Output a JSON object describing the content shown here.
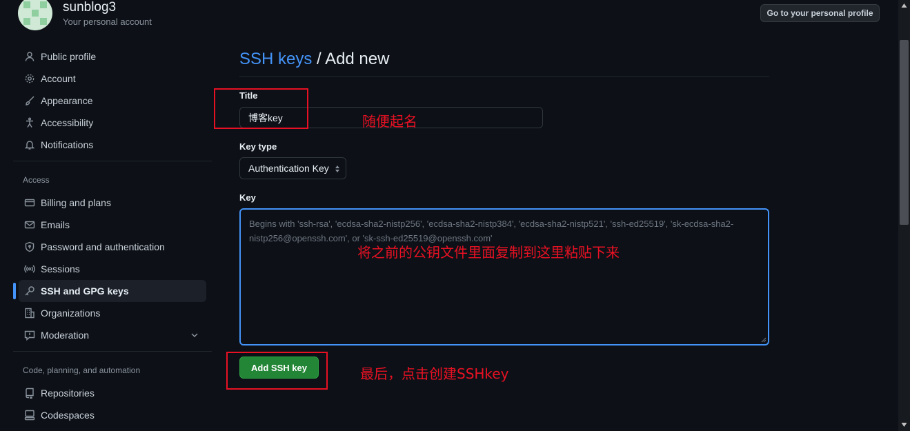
{
  "account": {
    "name": "sunblog3",
    "subtitle": "Your personal account",
    "profile_button": "Go to your personal profile"
  },
  "sidebar": {
    "items": [
      {
        "label": "Public profile",
        "icon": "person-icon"
      },
      {
        "label": "Account",
        "icon": "gear-icon"
      },
      {
        "label": "Appearance",
        "icon": "paintbrush-icon"
      },
      {
        "label": "Accessibility",
        "icon": "accessibility-icon"
      },
      {
        "label": "Notifications",
        "icon": "bell-icon"
      }
    ],
    "access_title": "Access",
    "access_items": [
      {
        "label": "Billing and plans",
        "icon": "credit-card-icon"
      },
      {
        "label": "Emails",
        "icon": "mail-icon"
      },
      {
        "label": "Password and authentication",
        "icon": "shield-lock-icon"
      },
      {
        "label": "Sessions",
        "icon": "broadcast-icon"
      },
      {
        "label": "SSH and GPG keys",
        "icon": "key-icon"
      },
      {
        "label": "Organizations",
        "icon": "organization-icon"
      },
      {
        "label": "Moderation",
        "icon": "report-icon"
      }
    ],
    "code_title": "Code, planning, and automation",
    "code_items": [
      {
        "label": "Repositories",
        "icon": "repo-icon"
      },
      {
        "label": "Codespaces",
        "icon": "codespaces-icon"
      }
    ]
  },
  "main": {
    "breadcrumb_link": "SSH keys",
    "breadcrumb_sep": " / ",
    "page_title": "Add new",
    "title_label": "Title",
    "title_value": "博客key",
    "key_type_label": "Key type",
    "key_type_value": "Authentication Key",
    "key_label": "Key",
    "key_placeholder": "Begins with 'ssh-rsa', 'ecdsa-sha2-nistp256', 'ecdsa-sha2-nistp384', 'ecdsa-sha2-nistp521', 'ssh-ed25519', 'sk-ecdsa-sha2-nistp256@openssh.com', or 'sk-ssh-ed25519@openssh.com'",
    "submit_label": "Add SSH key"
  },
  "annotations": {
    "title_note": "随便起名",
    "key_note": "将之前的公钥文件里面复制到这里粘贴下来",
    "button_note": "最后，点击创建SSHkey",
    "color": "#e81123"
  }
}
